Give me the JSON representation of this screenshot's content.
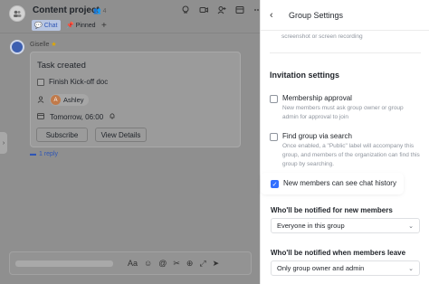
{
  "chat": {
    "title": "Content project",
    "member_count": "4",
    "tabs": [
      {
        "label": "Chat"
      },
      {
        "label": "Pinned"
      }
    ],
    "sender": "Giselle",
    "card": {
      "title": "Task created",
      "task": "Finish Kick-off doc",
      "assignee": "Ashley",
      "assignee_initial": "A",
      "due": "Tomorrow, 06:00",
      "subscribe_label": "Subscribe",
      "view_label": "View Details"
    },
    "reply": "1 reply"
  },
  "panel": {
    "title": "Group Settings",
    "prev_text": "screenshot or screen recording",
    "section_title": "Invitation settings",
    "options": [
      {
        "label": "Membership approval",
        "desc": "New members must ask group owner or group admin for approval to join",
        "checked": false
      },
      {
        "label": "Find group via search",
        "desc": "Once enabled, a \"Public\" label will accompany this group, and members of the organization can find this group by searching.",
        "checked": false
      },
      {
        "label": "New members can see chat history",
        "checked": true
      }
    ],
    "notify_new_heading": "Who'll be notified for new members",
    "notify_new_value": "Everyone in this group",
    "notify_leave_heading": "Who'll be notified when members leave",
    "notify_leave_value": "Only group owner and admin"
  }
}
